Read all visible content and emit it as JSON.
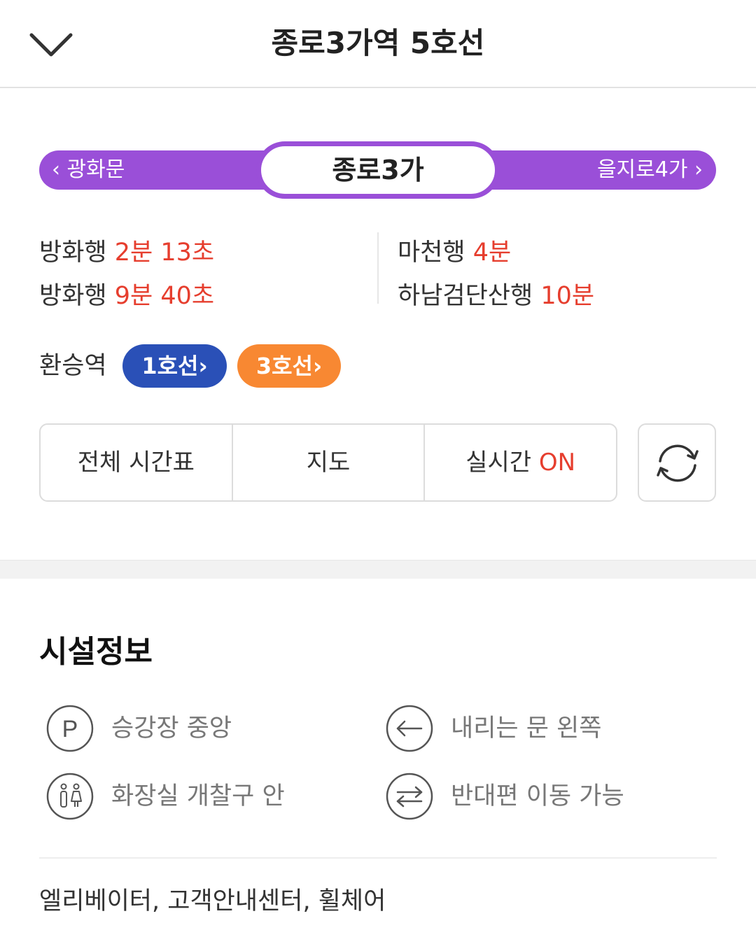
{
  "header": {
    "title": "종로3가역 5호선",
    "back_icon": "chevron-down-icon"
  },
  "line": {
    "color": "#9a4fd8",
    "prev_station": "광화문",
    "current_station": "종로3가",
    "next_station": "을지로4가"
  },
  "arrivals": {
    "left": [
      {
        "dest": "방화행",
        "time": "2분 13초"
      },
      {
        "dest": "방화행",
        "time": "9분 40초"
      }
    ],
    "right": [
      {
        "dest": "마천행",
        "time": "4분"
      },
      {
        "dest": "하남검단산행",
        "time": "10분"
      }
    ],
    "time_color": "#e63e2e"
  },
  "transfer": {
    "label": "환승역",
    "lines": [
      {
        "label": "1호선",
        "color": "#2a50b7"
      },
      {
        "label": "3호선",
        "color": "#f88832"
      }
    ]
  },
  "actions": {
    "timetable": "전체 시간표",
    "map": "지도",
    "realtime": "실시간",
    "realtime_state": "ON",
    "refresh_icon": "refresh-icon"
  },
  "facilities": {
    "title": "시설정보",
    "items": [
      {
        "icon": "parking-icon",
        "label": "승강장 중앙"
      },
      {
        "icon": "arrow-left-icon",
        "label": "내리는 문 왼쪽"
      },
      {
        "icon": "restroom-icon",
        "label": "화장실 개찰구 안"
      },
      {
        "icon": "swap-arrows-icon",
        "label": "반대편 이동 가능"
      }
    ],
    "extras": "엘리베이터, 고객안내센터, 휠체어"
  }
}
